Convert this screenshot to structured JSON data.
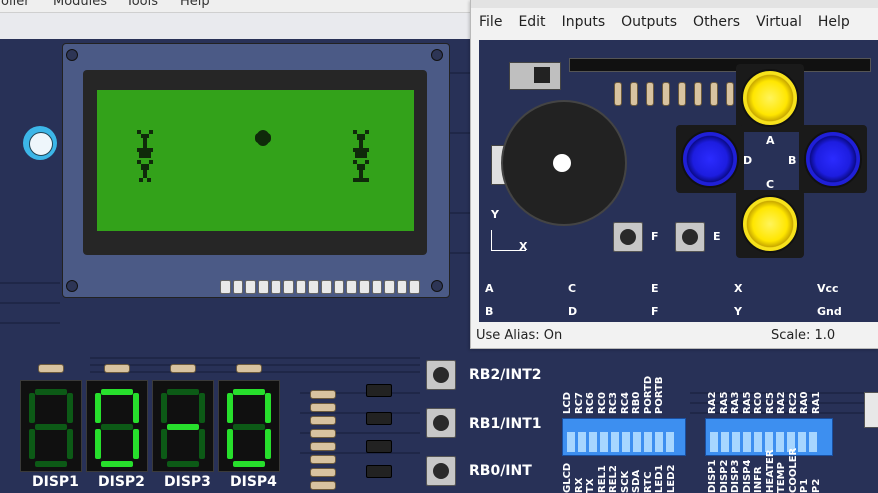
{
  "back_window": {
    "menu": [
      "roller",
      "Modules",
      "Tools",
      "Help"
    ]
  },
  "lcd": {
    "pin_count": 16
  },
  "displays": [
    {
      "label": "DISP1",
      "segments": []
    },
    {
      "label": "DISP2",
      "segments": [
        "a",
        "b",
        "c",
        "d",
        "e",
        "f"
      ]
    },
    {
      "label": "DISP3",
      "segments": [
        "g"
      ]
    },
    {
      "label": "DISP4",
      "segments": [
        "a",
        "b",
        "c",
        "d",
        "e",
        "f"
      ]
    }
  ],
  "buttons": [
    {
      "label": "RB2/INT2"
    },
    {
      "label": "RB1/INT1"
    },
    {
      "label": "RB0/INT"
    }
  ],
  "dip_left": {
    "top_labels": [
      "LCD",
      "RC7",
      "RC6",
      "RC0",
      "RC3",
      "RC4",
      "RB0",
      "PORTD",
      "PORTB"
    ],
    "bottom_labels": [
      "GLCD",
      "RX",
      "TX",
      "REL1",
      "REL2",
      "SCK",
      "SDA",
      "RTC",
      "LED1",
      "LED2"
    ]
  },
  "dip_right": {
    "top_labels": [
      "RA2",
      "RA5",
      "RA3",
      "RA5",
      "RC0",
      "RC5",
      "RA2",
      "RC2",
      "RA0",
      "RA1"
    ],
    "bottom_labels": [
      "DISP1",
      "DISP2",
      "DISP3",
      "DISP4",
      "INFR",
      "HEATER",
      "TEMP",
      "COOLER",
      "P1",
      "P2"
    ]
  },
  "window": {
    "menu": [
      "File",
      "Edit",
      "Inputs",
      "Outputs",
      "Others",
      "Virtual",
      "Help"
    ],
    "status_alias": "Use Alias: On",
    "status_scale": "Scale: 1.0",
    "axis_y": "Y",
    "axis_x": "X",
    "button_labels": {
      "a": "A",
      "b": "B",
      "c": "C",
      "d": "D",
      "e": "E",
      "f": "F"
    },
    "pin_rows": [
      [
        "A",
        "C",
        "E",
        "X",
        "Vcc"
      ],
      [
        "B",
        "D",
        "F",
        "Y",
        "Gnd"
      ]
    ]
  },
  "colors": {
    "board": "#283157",
    "lcd_green": "#33a21a",
    "segment_on": "#27df2c",
    "arcade_yellow": "#ffe600",
    "arcade_blue": "#1d1de0"
  }
}
